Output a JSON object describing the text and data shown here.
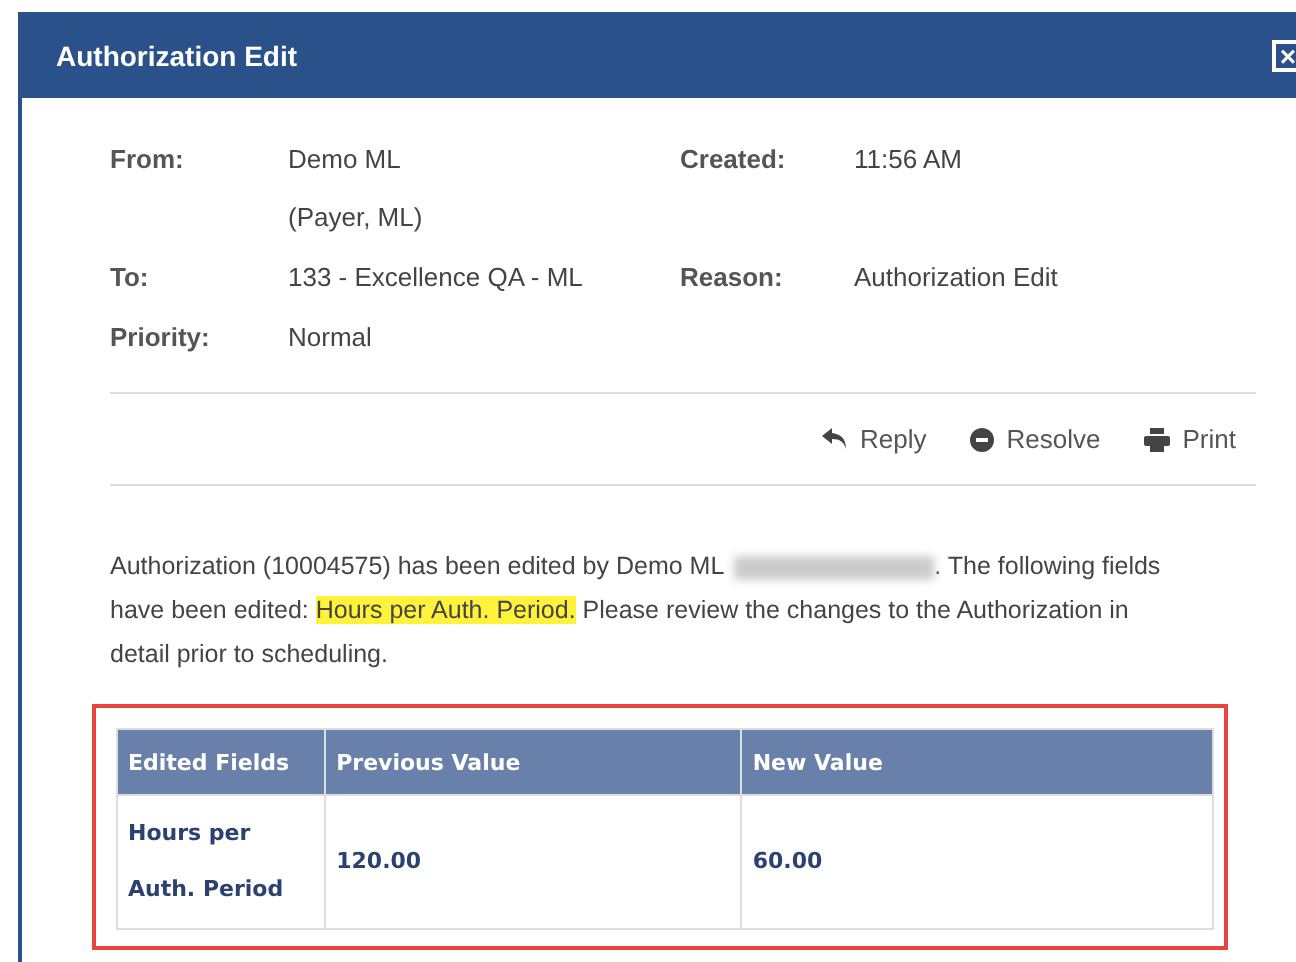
{
  "window": {
    "title": "Authorization Edit",
    "close": "×"
  },
  "details": [
    {
      "label": "From:",
      "lines": [
        "Demo ML",
        "(Payer, ML)"
      ],
      "label2": "Created:",
      "value2": "11:56 AM"
    },
    {
      "label": "To:",
      "lines": [
        "133 - Excellence QA - ML"
      ],
      "label2": "Reason:",
      "value2": "Authorization Edit"
    },
    {
      "label": "Priority:",
      "lines": [
        "Normal"
      ]
    }
  ],
  "actions": [
    {
      "kind": "reply",
      "label": "Reply"
    },
    {
      "kind": "resolve",
      "label": "Resolve"
    },
    {
      "kind": "print",
      "label": "Print"
    }
  ],
  "message": {
    "before": "Authorization (10004575) has been edited by Demo ML",
    "after": ". The following fields have been edited: ",
    "highlight": "Hours per Auth. Period.",
    "end": " Please review the changes to the Authorization in detail prior to scheduling."
  },
  "table": {
    "columns": [
      "Edited Fields",
      "Previous Value",
      "New Value"
    ],
    "rows": [
      [
        "Hours per Auth. Period",
        "120.00",
        "60.00"
      ]
    ]
  }
}
